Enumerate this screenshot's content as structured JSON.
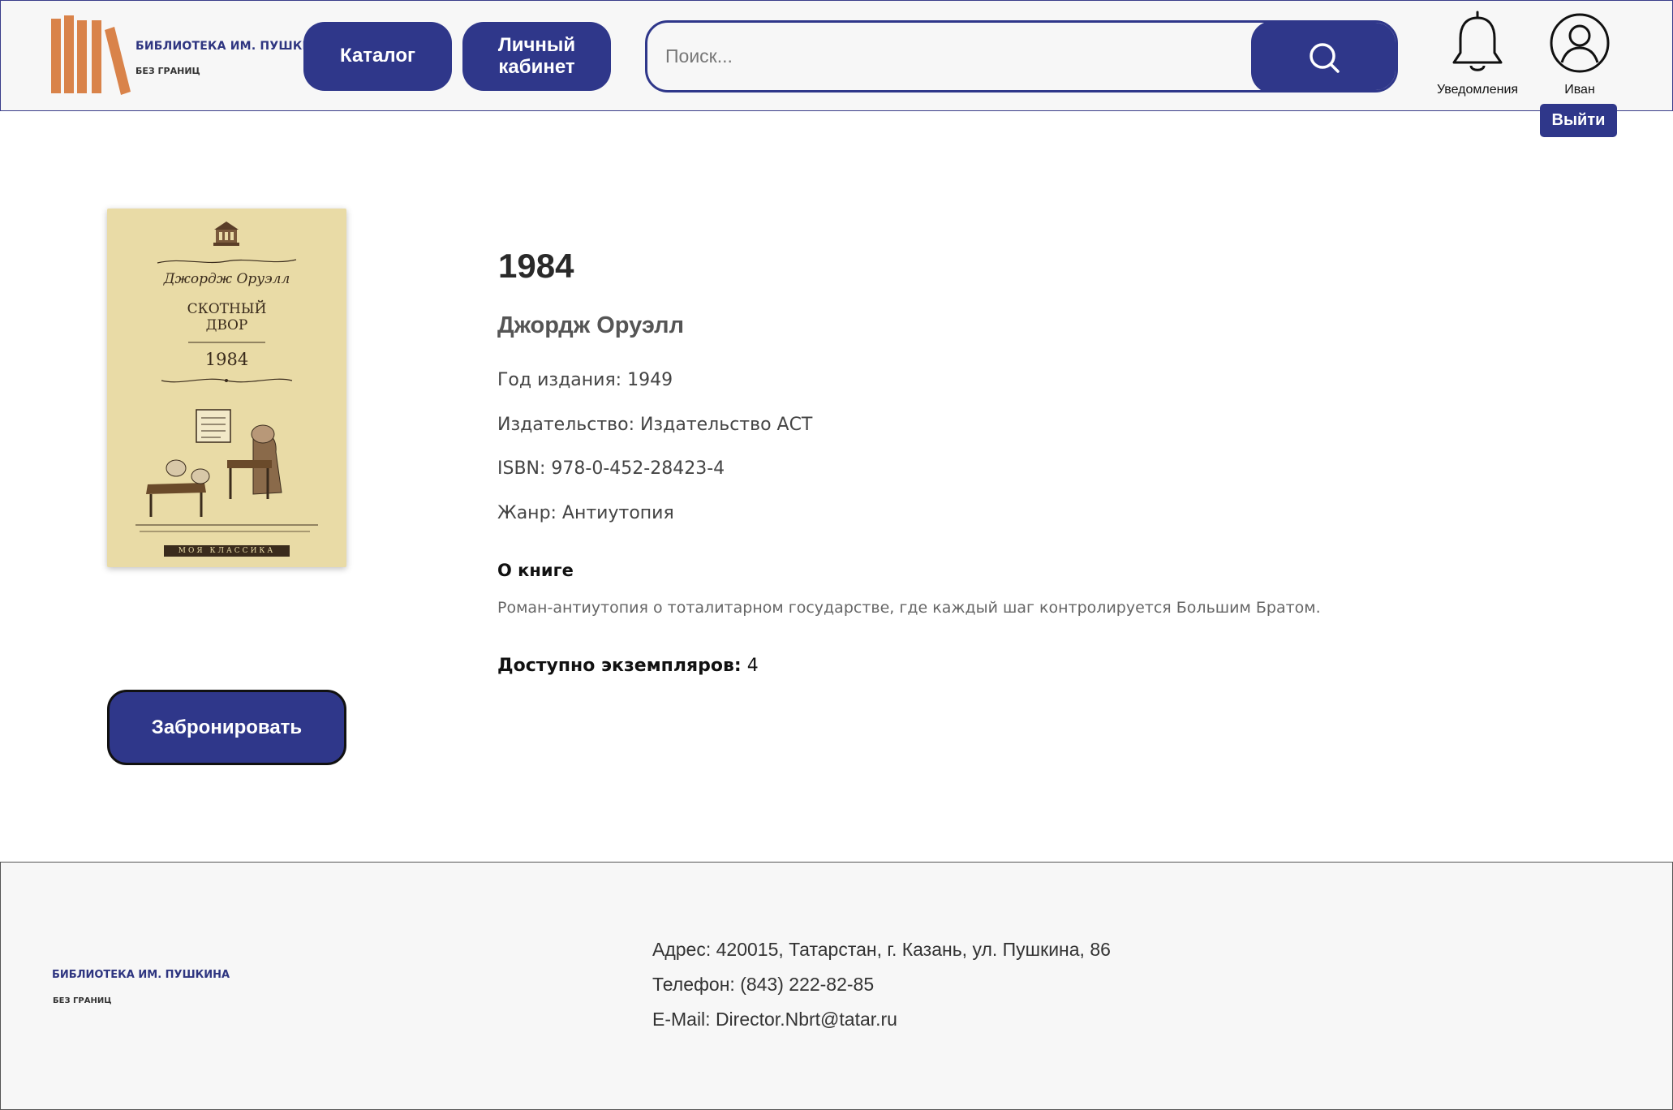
{
  "header": {
    "logo_title": "БИБЛИОТЕКА ИМ. ПУШКИНА",
    "logo_subtitle": "БЕЗ ГРАНИЦ",
    "nav": {
      "catalog": "Каталог",
      "cabinet": "Личный кабинет"
    },
    "search": {
      "placeholder": "Поиск...",
      "value": ""
    },
    "notifications_label": "Уведомления",
    "user_name": "Иван",
    "logout_label": "Выйти"
  },
  "book": {
    "cover": {
      "author": "Джордж Оруэлл",
      "title": "СКОТНЫЙ ДВОР",
      "year": "1984",
      "series": "МОЯ КЛАССИКА"
    },
    "title": "1984",
    "author": "Джордж Оруэлл",
    "year_label": "Год издания: 1949",
    "publisher_label": "Издательство: Издательство АСТ",
    "isbn_label": "ISBN: 978-0-452-28423-4",
    "genre_label": "Жанр: Антиутопия",
    "about_heading": "О книге",
    "about_text": "Роман-антиутопия о тоталитарном государстве, где каждый шаг контролируется Большим Братом.",
    "available_label": "Доступно экземпляров:",
    "available_count": "4",
    "reserve_label": "Забронировать"
  },
  "footer": {
    "logo_title": "БИБЛИОТЕКА ИМ. ПУШКИНА",
    "logo_subtitle": "БЕЗ ГРАНИЦ",
    "address": "Адрес: 420015, Татарстан, г. Казань, ул. Пушкина, 86",
    "phone": "Телефон: (843) 222-82-85",
    "email": "E-Mail: Director.Nbrt@tatar.ru"
  },
  "colors": {
    "primary": "#2f378a",
    "logo_books": "#d9834a",
    "background": "#f7f7f7"
  }
}
